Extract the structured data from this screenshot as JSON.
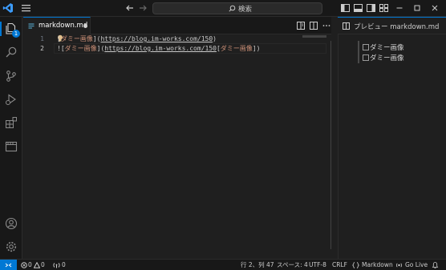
{
  "titlebar": {
    "search_label": "検索"
  },
  "activity": {
    "explorer_badge": "1"
  },
  "editor": {
    "tab_label": "markdown.md",
    "line_numbers": [
      "1",
      "2"
    ],
    "line1": {
      "open": "[",
      "alt": "ダミー画像",
      "mid": "](",
      "url": "https://blog.im-works.com/150",
      "close": ")"
    },
    "line2": {
      "open": "![",
      "alt": "ダミー画像",
      "mid": "](",
      "url": "https://blog.im-works.com/150",
      "rest_open": "[",
      "rest_alt": "ダミー画像",
      "rest_close": "])"
    }
  },
  "preview": {
    "tab_label": "プレビュー markdown.md",
    "images": [
      "ダミー画像",
      "ダミー画像"
    ]
  },
  "statusbar": {
    "errors": "0",
    "warnings": "0",
    "ports": "0",
    "position": "行 2、列 47",
    "spaces": "スペース: 4",
    "encoding": "UTF-8",
    "eol": "CRLF",
    "language": "Markdown",
    "golive": "Go Live"
  },
  "colors": {
    "accent": "#0078d4",
    "string": "#ce9178",
    "background": "#1f1f1f"
  }
}
